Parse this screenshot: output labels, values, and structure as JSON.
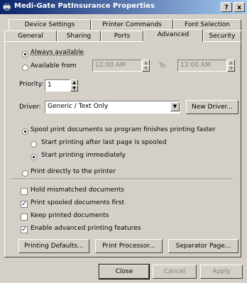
{
  "window": {
    "title": "Medi-Gate PatInsurance Properties",
    "help_label": "?",
    "close_label": "x"
  },
  "tabs_row1": [
    "Device Settings",
    "Printer Commands",
    "Font Selection"
  ],
  "tabs_row2": [
    "General",
    "Sharing",
    "Ports",
    "Advanced",
    "Security"
  ],
  "selected_tab": "Advanced",
  "availability": {
    "always_label": "Always available",
    "always_selected": true,
    "from_label": "Available from",
    "from_value": "12:00 AM",
    "to_label": "To",
    "to_value": "12:00 AM"
  },
  "priority": {
    "label": "Priority:",
    "value": "1"
  },
  "driver": {
    "label": "Driver:",
    "value": "Generic / Text Only",
    "new_driver_label": "New Driver..."
  },
  "spool": {
    "spool_label": "Spool print documents so program finishes printing faster",
    "after_last_label": "Start printing after last page is spooled",
    "immediately_label": "Start printing immediately",
    "direct_label": "Print directly to the printer"
  },
  "options": {
    "hold_label": "Hold mismatched documents",
    "hold_checked": false,
    "spooled_first_label": "Print spooled documents first",
    "spooled_first_checked": true,
    "keep_label": "Keep printed documents",
    "keep_checked": false,
    "advanced_label": "Enable advanced printing features",
    "advanced_checked": true
  },
  "panel_buttons": {
    "defaults": "Printing Defaults...",
    "processor": "Print Processor...",
    "separator": "Separator Page..."
  },
  "dialog_buttons": {
    "close": "Close",
    "cancel": "Cancel",
    "apply": "Apply"
  },
  "icons": {
    "title_icon": "printer-icon",
    "check_mark": "✓",
    "up_arrow": "▲",
    "down_arrow": "▼"
  }
}
